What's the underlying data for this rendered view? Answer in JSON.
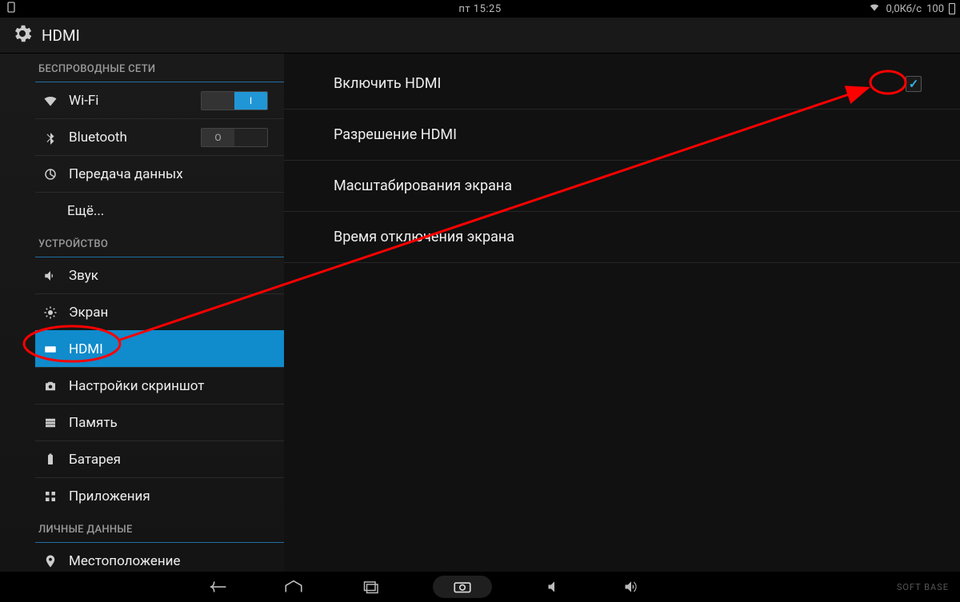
{
  "status": {
    "time": "пт 15:25",
    "net_speed": "0,0Кб/с",
    "battery": "100"
  },
  "header": {
    "title": "HDMI"
  },
  "sidebar": {
    "section_wireless": "БЕСПРОВОДНЫЕ СЕТИ",
    "wifi": "Wi-Fi",
    "bluetooth": "Bluetooth",
    "data_usage": "Передача данных",
    "more": "Ещё...",
    "section_device": "УСТРОЙСТВО",
    "sound": "Звук",
    "display": "Экран",
    "hdmi": "HDMI",
    "screenshot": "Настройки скриншот",
    "storage": "Память",
    "battery_item": "Батарея",
    "apps": "Приложения",
    "section_personal": "ЛИЧНЫЕ ДАННЫЕ",
    "location": "Местоположение",
    "toggle_on": "I",
    "toggle_off": "O"
  },
  "content": {
    "enable_hdmi": "Включить HDMI",
    "resolution": "Разрешение HDMI",
    "scaling": "Масштабирования экрана",
    "screen_off": "Время отключения экрана"
  },
  "nav": {
    "brand": "SOFT  BASE"
  }
}
